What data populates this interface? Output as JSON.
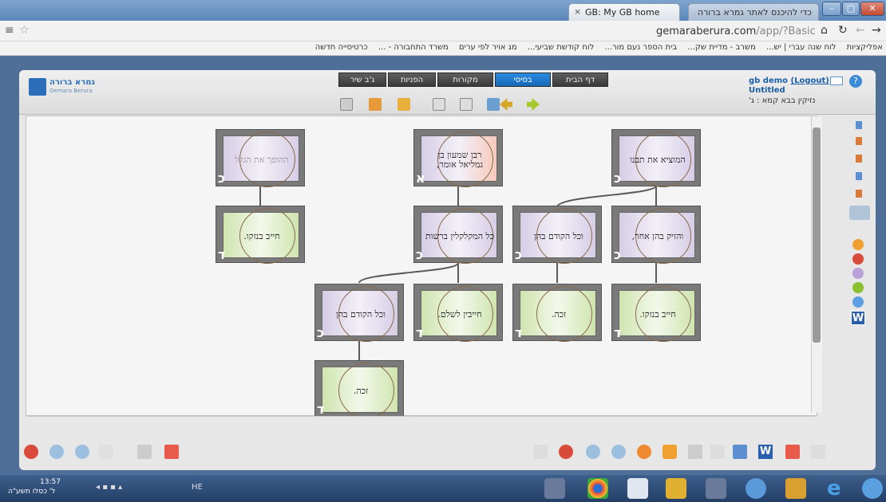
{
  "browser": {
    "tabs": [
      {
        "title": "GB: My GB home"
      },
      {
        "title": "כדי להיכנס לאתר גמרא ברורה"
      }
    ],
    "url_domain": "gemaraberura.com",
    "url_path": "/app/?Basic",
    "bookmarks": [
      "אפליקציות",
      "לוח שנה עברי | יש...",
      "משרב - מדיית שק...",
      "בית הספר נעם מור...",
      "לוח קודשת שביעי...",
      "מג אויר לפי ערים",
      "משרד התחבורה - ...",
      "כרטיסייה חדשה"
    ]
  },
  "app": {
    "logo_text": "גמרא ברורה",
    "logo_sub": "Gemara Berura",
    "tabs": [
      {
        "label": "דף הבית",
        "active": false
      },
      {
        "label": "בסיסי",
        "active": true
      },
      {
        "label": "מקורות",
        "active": false
      },
      {
        "label": "הפניות",
        "active": false
      },
      {
        "label": "ג'ב שיר",
        "active": false
      }
    ],
    "user": "gb demo",
    "logout": "(Logout)",
    "doc_title": "Untitled",
    "source_ref": "נזיקין בבא קמא : ג'"
  },
  "nodes": [
    {
      "id": "n1",
      "text": "ההופך את הגלל",
      "letter": "כ",
      "type": "kaf"
    },
    {
      "id": "n2",
      "text": "רבן שמעון בן גמליאל אומר,",
      "letter": "א",
      "type": "alef"
    },
    {
      "id": "n3",
      "text": "המוציא את תבנו",
      "letter": "כ",
      "type": "kaf"
    },
    {
      "id": "n4",
      "text": "חייב בנזקו.",
      "letter": "ד",
      "type": "dalet"
    },
    {
      "id": "n5",
      "text": "כל המקלקלין ברשות",
      "letter": "כ",
      "type": "kaf"
    },
    {
      "id": "n6",
      "text": "וכל הקודם בהן",
      "letter": "כ",
      "type": "kaf"
    },
    {
      "id": "n7",
      "text": "והזיק בהן אחר,",
      "letter": "כ",
      "type": "kaf"
    },
    {
      "id": "n8",
      "text": "וכל הקודם בהן",
      "letter": "כ",
      "type": "kaf"
    },
    {
      "id": "n9",
      "text": "חייבין לשלם.",
      "letter": "ד",
      "type": "dalet"
    },
    {
      "id": "n10",
      "text": "זכה.",
      "letter": "ד",
      "type": "dalet"
    },
    {
      "id": "n11",
      "text": "חייב בנזקו.",
      "letter": "ד",
      "type": "dalet"
    },
    {
      "id": "n12",
      "text": "זכה.",
      "letter": "ד",
      "type": "dalet"
    }
  ],
  "taskbar": {
    "time": "13:57",
    "date": "ל' כסלו תשע\"ה",
    "lang": "HE"
  }
}
